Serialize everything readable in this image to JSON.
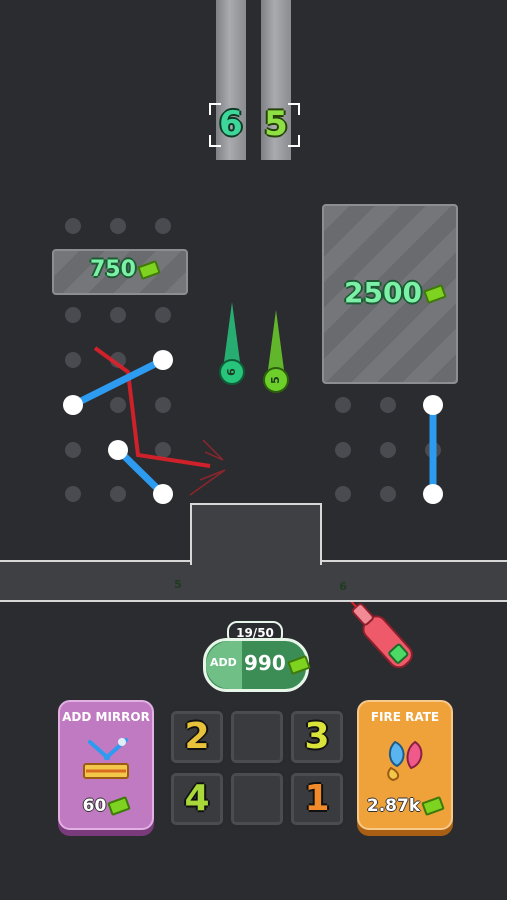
{
  "colors": {
    "background": "#2b2c30",
    "green_ball": "#27c47c",
    "lime_ball": "#6ccf2a",
    "mirror_blue": "#2d9bf0",
    "laser_red": "#e0202a",
    "mirror_card": "#c07ac2",
    "fire_rate_card": "#f0a23a"
  },
  "top_counters": {
    "left": "6",
    "right": "5"
  },
  "panels": {
    "small_price": "750",
    "large_price": "2500"
  },
  "falling_balls": [
    "6",
    "5"
  ],
  "track_balls": [
    "5",
    "9"
  ],
  "add_button": {
    "counter": "19/50",
    "label": "ADD",
    "cost": "990"
  },
  "merge_grid": [
    "2",
    "",
    "3",
    "4",
    "",
    "1"
  ],
  "cards": {
    "add_mirror": {
      "title": "ADD MIRROR",
      "price": "60",
      "icon": "mirror-icon"
    },
    "fire_rate": {
      "title": "FIRE RATE",
      "price": "2.87k",
      "icon": "paint-drops-icon"
    }
  },
  "icons": [
    "laser-gun-icon",
    "cash-icon"
  ]
}
